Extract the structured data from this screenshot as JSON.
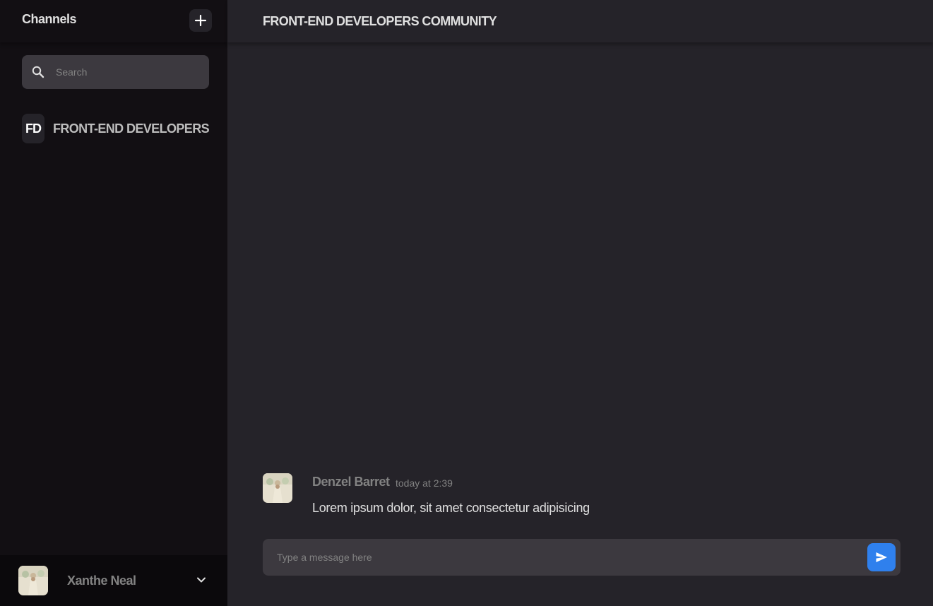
{
  "sidebar": {
    "title": "Channels",
    "search": {
      "placeholder": "Search",
      "value": ""
    },
    "channels": [
      {
        "abbr": "FD",
        "name": "FRONT-END DEVELOPERS"
      }
    ],
    "user": {
      "name": "Xanthe Neal"
    }
  },
  "main": {
    "channel_title": "FRONT-END DEVELOPERS COMMUNITY",
    "messages": [
      {
        "author": "Denzel Barret",
        "time": "today at 2:39",
        "text": "Lorem ipsum dolor, sit amet consectetur adipisicing"
      }
    ],
    "composer": {
      "placeholder": "Type a message here",
      "value": ""
    }
  },
  "icons": {
    "add": "plus-icon",
    "search": "search-icon",
    "chevron": "chevron-down-icon",
    "send": "send-icon"
  },
  "colors": {
    "sidebar_bg": "#120f13",
    "main_bg": "#252329",
    "input_bg": "#3c393f",
    "accent": "#2f80ed",
    "muted_text": "#828282",
    "text": "#e0e0e0"
  }
}
